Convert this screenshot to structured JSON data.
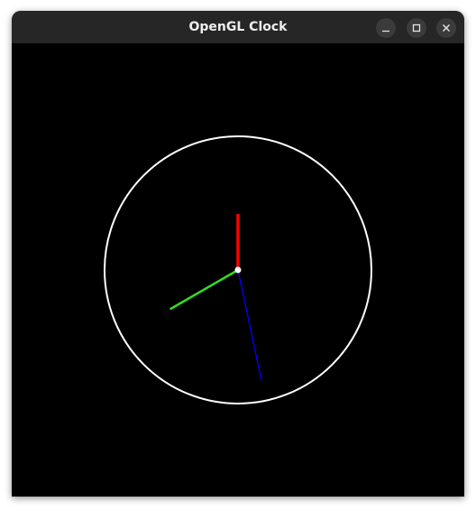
{
  "window": {
    "title": "OpenGL Clock",
    "controls": {
      "minimize_icon": "minimize-icon",
      "maximize_icon": "maximize-icon",
      "close_icon": "close-icon"
    }
  },
  "clock": {
    "background": "#000000",
    "face_color": "#ffffff",
    "center_dot_color": "#ffffff",
    "hands": {
      "hour": {
        "color": "#ff0000",
        "angle_deg": 0
      },
      "minute": {
        "color": "#33dd22",
        "angle_deg": 240
      },
      "second": {
        "color": "#0000ff",
        "angle_deg": 168
      }
    }
  }
}
